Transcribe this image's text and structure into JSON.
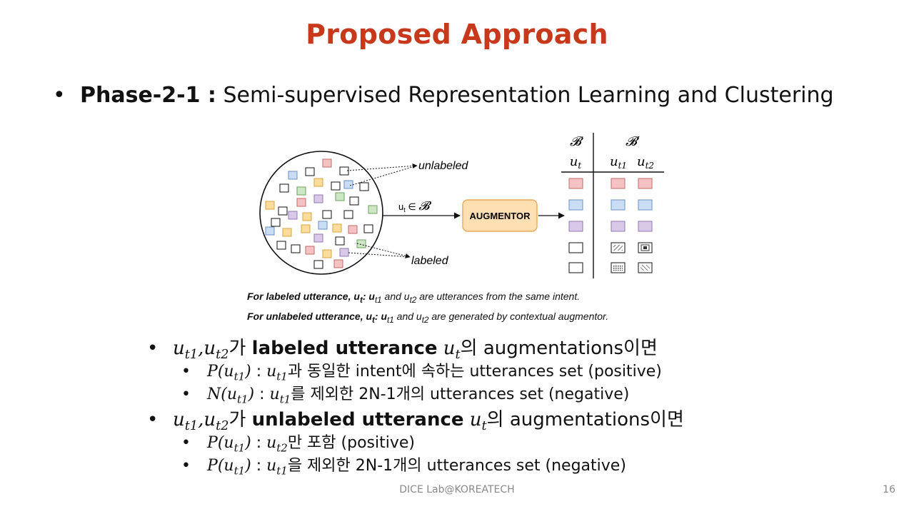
{
  "slide": {
    "title": "Proposed Approach",
    "phase_label": "Phase-2-1 :",
    "phase_text": "Semi-supervised Representation Learning and Clustering",
    "footer": "DICE  Lab@KOREATECH",
    "page_number": "16"
  },
  "figure": {
    "label_unlabeled": "unlabeled",
    "label_labeled": "labeled",
    "arrow_label": "u",
    "arrow_label_sub": "t",
    "arrow_label_rest": " ∈ ",
    "set_b": "𝓑",
    "augmentor": "AUGMENTOR",
    "col_b": "𝓑",
    "col_b_prime": "𝓑′",
    "col_ut": "u",
    "col_ut_sub": "t",
    "col_ut1": "u",
    "col_ut1_sub": "t1",
    "col_ut2": "u",
    "col_ut2_sub": "t2",
    "colors": {
      "red": "#f4c2c2",
      "blue": "#c9ddf5",
      "purple": "#d9c9e8",
      "yellow": "#fbdc9c",
      "green": "#cde6c4",
      "augmentor_fill": "#fddfb2",
      "augmentor_stroke": "#e8a95a"
    }
  },
  "caption": {
    "line1_bold": "For labeled utterance, u",
    "line1_bold_sub": "t",
    "line1_rest_a": ": u",
    "line1_sub_a": "t1",
    "line1_rest_b": " and u",
    "line1_sub_b": "t2",
    "line1_rest_c": " are utterances from the same intent.",
    "line2_bold": "For unlabeled utterance, u",
    "line2_bold_sub": "t",
    "line2_rest_a": ": u",
    "line2_sub_a": "t1",
    "line2_rest_b": " and u",
    "line2_sub_b": "t2",
    "line2_rest_c": " are generated by contextual augmentor."
  },
  "bullets": [
    {
      "u": "u",
      "s1": "t1",
      "comma": ",",
      "u2": "u",
      "s2": "t2",
      "ga": "가 ",
      "bold": "labeled utterance",
      "ut": "u",
      "ut_sub": "t",
      "rest": "의 augmentations이면",
      "children": [
        {
          "fn": "P",
          "arg": "u",
          "arg_sub": "t1",
          "sep": " : ",
          "v": "u",
          "v_sub": "t1",
          "text": "과 동일한 intent에 속하는 utterances set (positive)"
        },
        {
          "fn": "N",
          "arg": "u",
          "arg_sub": "t1",
          "sep": " : ",
          "v": "u",
          "v_sub": "t1",
          "text": "를 제외한 2N-1개의 utterances set (negative)"
        }
      ]
    },
    {
      "u": "u",
      "s1": "t1",
      "comma": ",",
      "u2": "u",
      "s2": "t2",
      "ga": "가 ",
      "bold": "unlabeled utterance",
      "ut": "u",
      "ut_sub": "t",
      "rest": "의 augmentations이면",
      "children": [
        {
          "fn": "P",
          "arg": "u",
          "arg_sub": "t1",
          "sep": " : ",
          "v": "u",
          "v_sub": "t2",
          "text": "만 포함 (positive)"
        },
        {
          "fn": "P",
          "arg": "u",
          "arg_sub": "t1",
          "sep": " : ",
          "v": "u",
          "v_sub": "t1",
          "text": "을 제외한 2N-1개의 utterances set (negative)"
        }
      ]
    }
  ]
}
